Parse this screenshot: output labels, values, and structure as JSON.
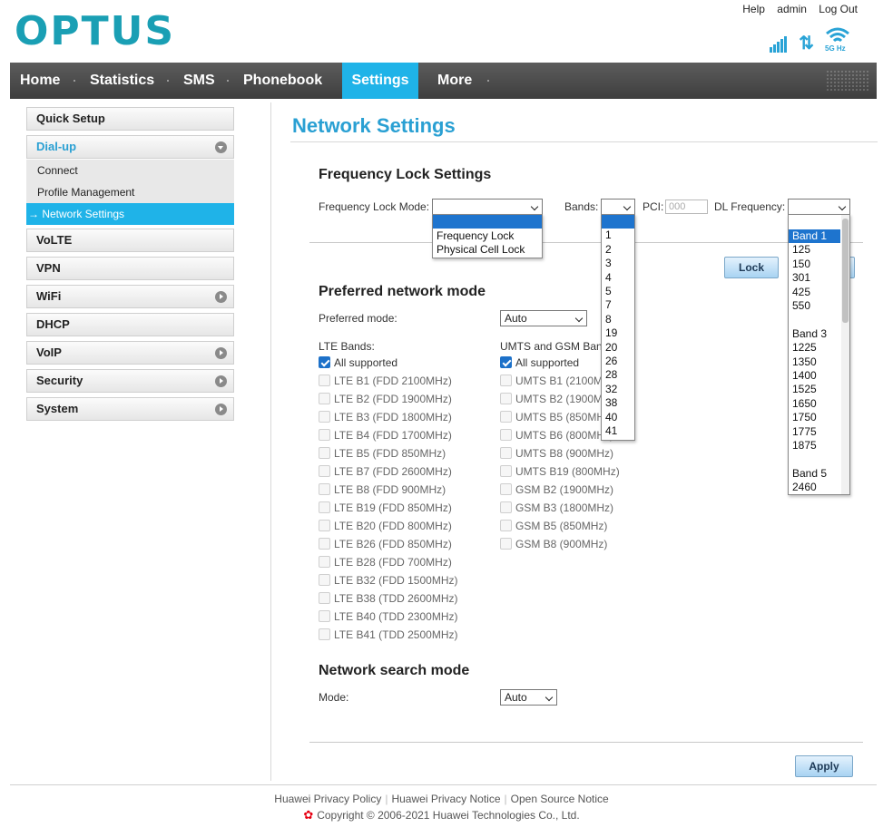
{
  "header": {
    "logo": "OPTUS",
    "links": [
      "Help",
      "admin",
      "Log Out"
    ],
    "wifi_label": "5G Hz"
  },
  "nav": {
    "items": [
      "Home",
      "Statistics",
      "SMS",
      "Phonebook",
      "Settings",
      "More"
    ],
    "active": "Settings"
  },
  "sidebar": {
    "quick_setup": "Quick Setup",
    "dialup": "Dial-up",
    "dialup_sub": [
      "Connect",
      "Profile Management",
      "→ Network Settings"
    ],
    "items": [
      "VoLTE",
      "VPN",
      "WiFi",
      "DHCP",
      "VoIP",
      "Security",
      "System"
    ]
  },
  "main": {
    "title": "Network Settings",
    "freq_section": "Frequency Lock Settings",
    "freq_mode_label": "Frequency Lock Mode:",
    "bands_label": "Bands:",
    "pci_label": "PCI:",
    "pci_placeholder": "000",
    "dl_freq_label": "DL Frequency:",
    "lock_button": "Lock",
    "pref_section": "Preferred network mode",
    "pref_mode_label": "Preferred mode:",
    "pref_mode_value": "Auto",
    "lte_label": "LTE Bands:",
    "umts_label": "UMTS and GSM Bands:",
    "lte_bands": [
      "All supported",
      "LTE B1 (FDD 2100MHz)",
      "LTE B2 (FDD 1900MHz)",
      "LTE B3 (FDD 1800MHz)",
      "LTE B4 (FDD 1700MHz)",
      "LTE B5 (FDD 850MHz)",
      "LTE B7 (FDD 2600MHz)",
      "LTE B8 (FDD 900MHz)",
      "LTE B19 (FDD 850MHz)",
      "LTE B20 (FDD 800MHz)",
      "LTE B26 (FDD 850MHz)",
      "LTE B28 (FDD 700MHz)",
      "LTE B32 (FDD 1500MHz)",
      "LTE B38 (TDD 2600MHz)",
      "LTE B40 (TDD 2300MHz)",
      "LTE B41 (TDD 2500MHz)"
    ],
    "umts_bands": [
      "All supported",
      "UMTS B1 (2100MHz)",
      "UMTS B2 (1900MHz)",
      "UMTS B5 (850MHz)",
      "UMTS B6 (800MHz)",
      "UMTS B8 (900MHz)",
      "UMTS B19 (800MHz)",
      "GSM B2 (1900MHz)",
      "GSM B3 (1800MHz)",
      "GSM B5 (850MHz)",
      "GSM B8 (900MHz)"
    ],
    "search_section": "Network search mode",
    "search_mode_label": "Mode:",
    "search_mode_value": "Auto",
    "apply_button": "Apply"
  },
  "dropdowns": {
    "freq_mode_options": [
      "",
      "Frequency Lock",
      "Physical Cell Lock"
    ],
    "bands_options": [
      "",
      "1",
      "2",
      "3",
      "4",
      "5",
      "7",
      "8",
      "19",
      "20",
      "26",
      "28",
      "32",
      "38",
      "40",
      "41"
    ],
    "dl_freq_options": [
      "Band 1",
      "125",
      "150",
      "301",
      "425",
      "550",
      "",
      "Band 3",
      "1225",
      "1350",
      "1400",
      "1525",
      "1650",
      "1750",
      "1775",
      "1875",
      "",
      "Band 5",
      "2460"
    ],
    "dl_freq_selected": "Band 1"
  },
  "footer": {
    "links": [
      "Huawei Privacy Policy",
      "Huawei Privacy Notice",
      "Open Source Notice"
    ],
    "copyright": "Copyright © 2006-2021 Huawei Technologies Co., Ltd."
  },
  "colors": {
    "brand": "#1a9fb4",
    "nav_active": "#1fb3e8",
    "title": "#2aa0d3",
    "selected": "#1e74ce"
  }
}
